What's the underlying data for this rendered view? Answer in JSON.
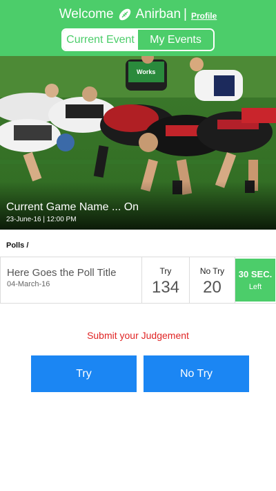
{
  "header": {
    "welcome": "Welcome",
    "user_name": "Anirban",
    "separator": "|",
    "profile_link": "Profile",
    "tabs": [
      {
        "label": "Current Event",
        "active": true
      },
      {
        "label": "My Events",
        "active": false
      }
    ]
  },
  "hero": {
    "game_name": "Current Game Name ... On",
    "game_date": "23-June-16 | 12:00 PM",
    "jersey_text": "Works"
  },
  "polls": {
    "section_label": "Polls /",
    "items": [
      {
        "title": "Here Goes the Poll Title",
        "date": "04-March-16",
        "try_label": "Try",
        "try_count": "134",
        "notry_label": "No Try",
        "notry_count": "20",
        "timer_value": "30 SEC.",
        "timer_label": "Left"
      }
    ]
  },
  "judgement": {
    "prompt": "Submit your Judgement",
    "try_button": "Try",
    "notry_button": "No Try"
  },
  "colors": {
    "brand_green": "#4ccd6a",
    "button_blue": "#1b86f3",
    "prompt_red": "#e02424"
  },
  "icons": {
    "header_icon": "rugby-ball-icon"
  }
}
